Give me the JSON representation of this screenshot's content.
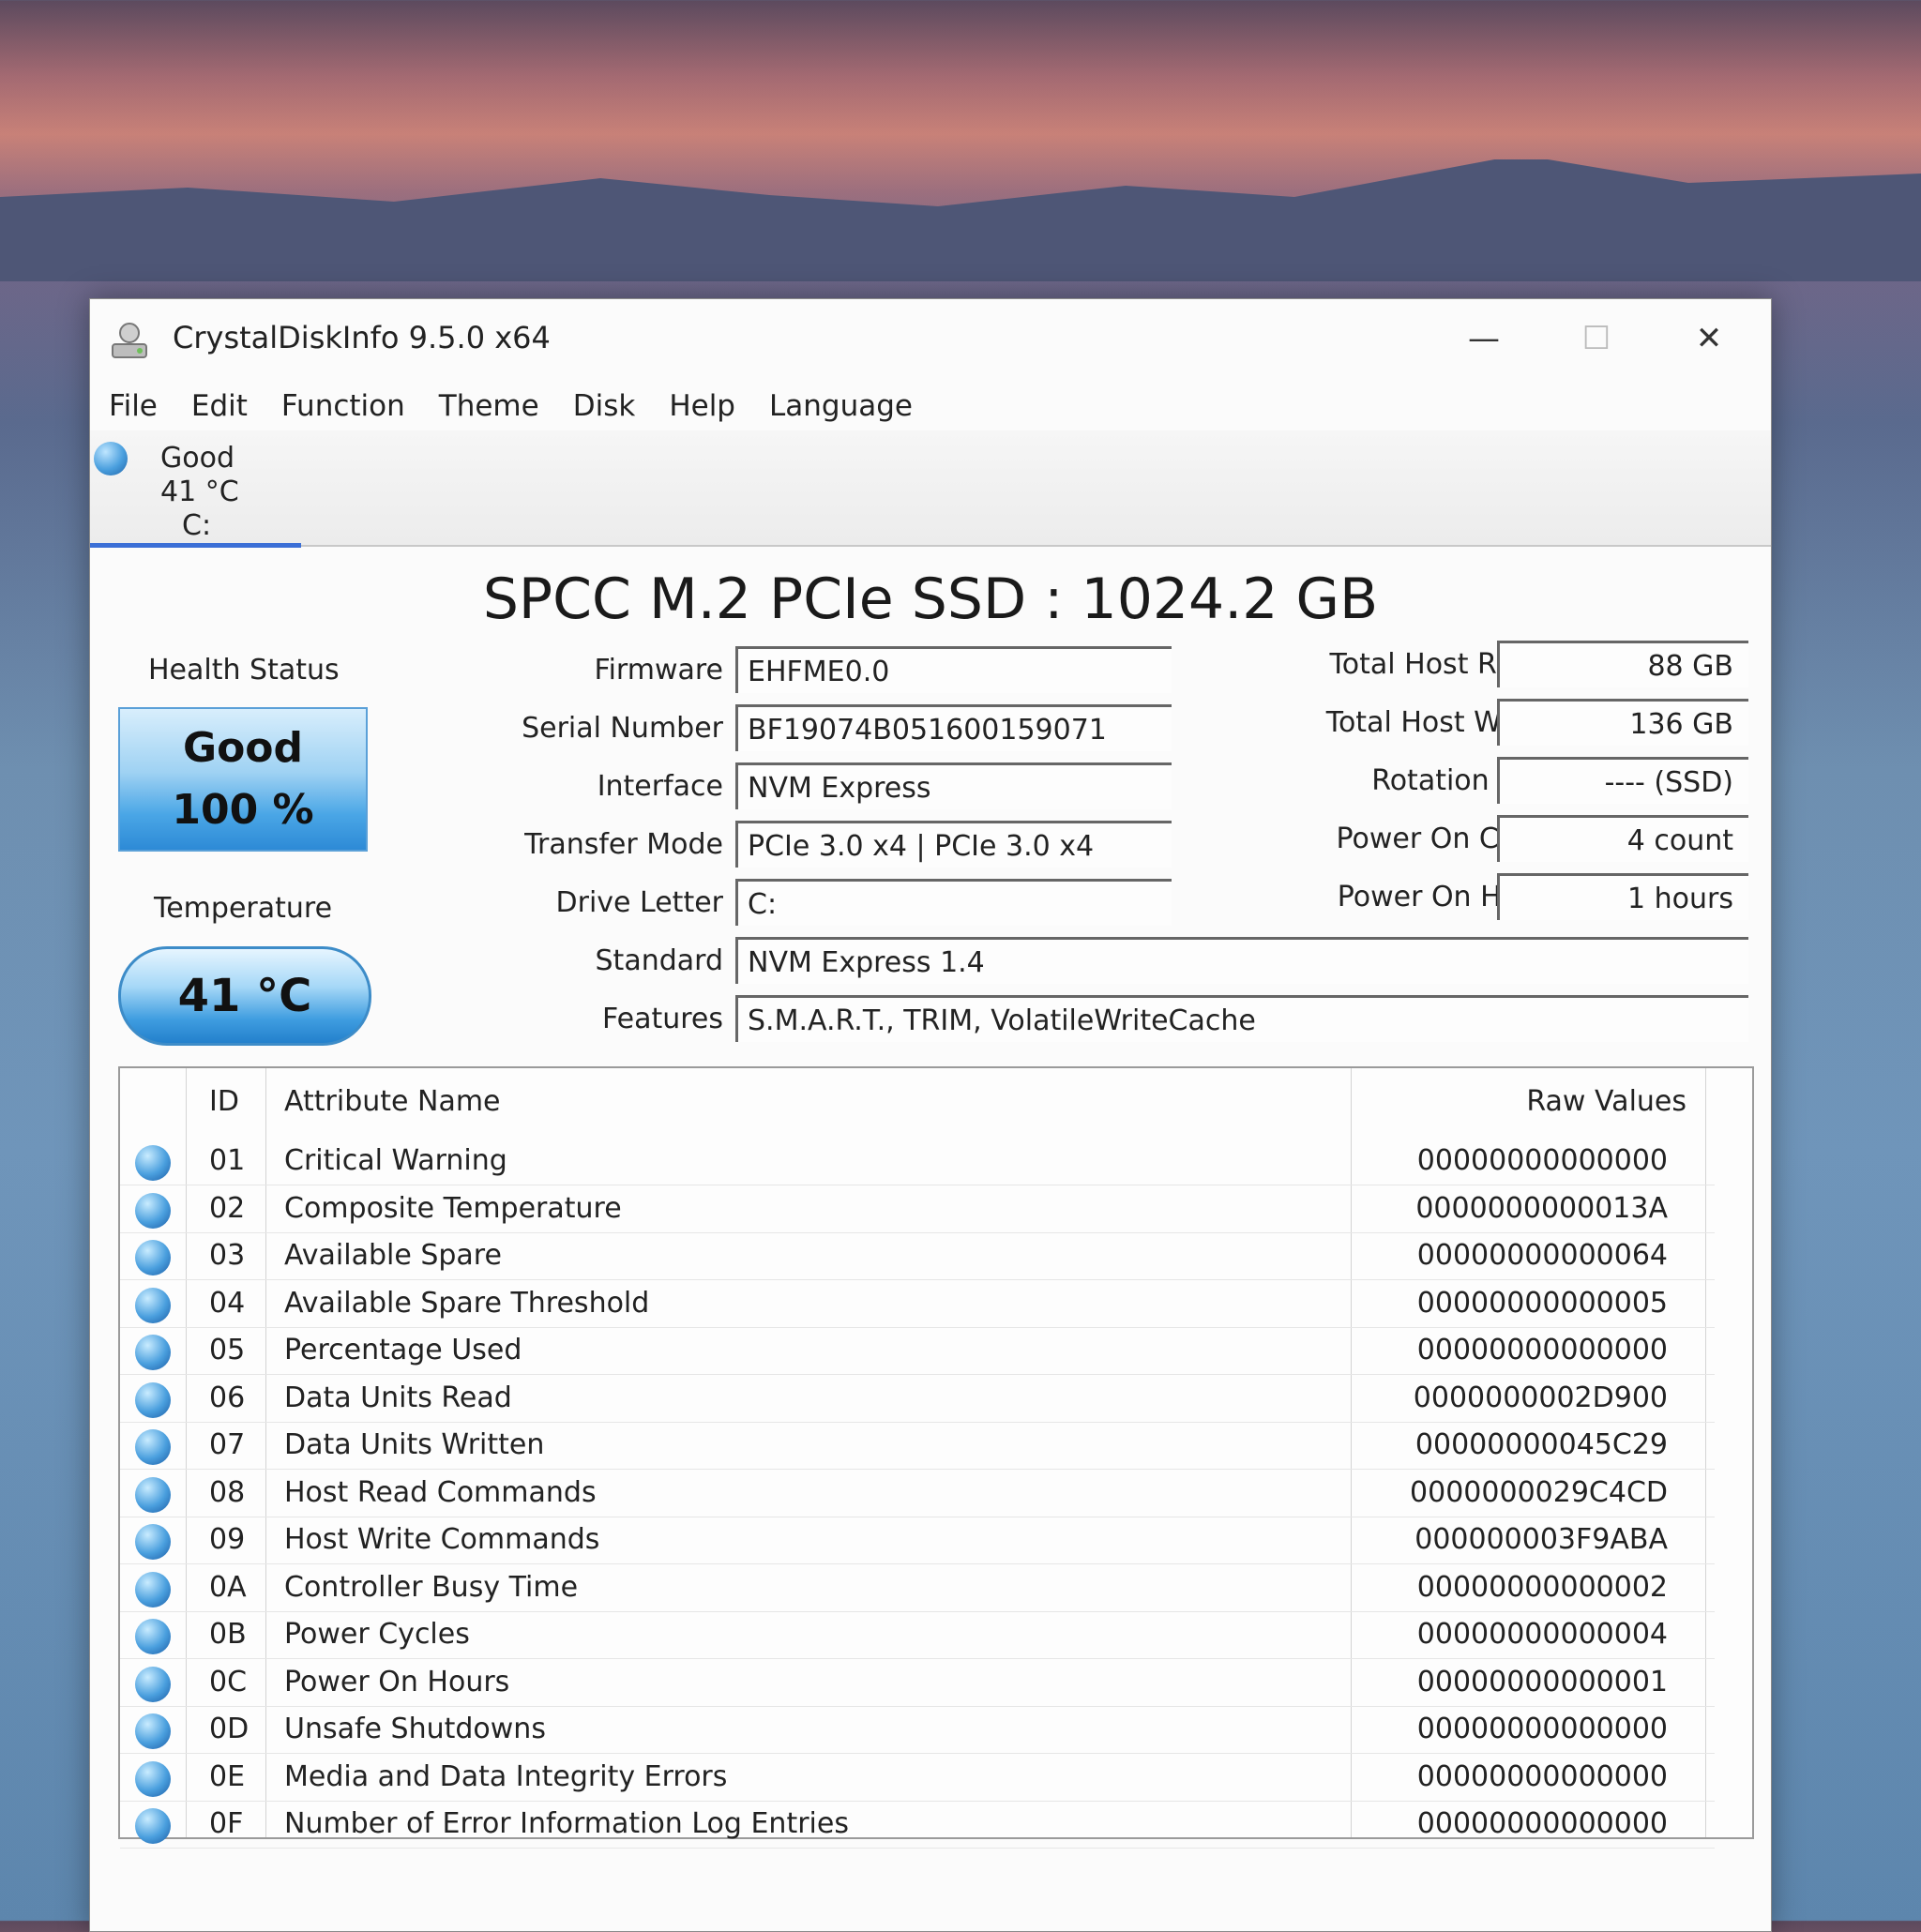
{
  "window": {
    "title": "CrystalDiskInfo 9.5.0 x64",
    "minimize": "—",
    "maximize": "☐",
    "close": "✕"
  },
  "menu": [
    "File",
    "Edit",
    "Function",
    "Theme",
    "Disk",
    "Help",
    "Language"
  ],
  "drive_tab": {
    "status": "Good",
    "temp": "41 °C",
    "letter": "C:",
    "status_color": "#4a9fde"
  },
  "model": "SPCC M.2 PCIe SSD : 1024.2 GB",
  "health": {
    "label": "Health Status",
    "status": "Good",
    "percent": "100 %",
    "color": "#4aa6e6"
  },
  "temperature": {
    "label": "Temperature",
    "value": "41 °C"
  },
  "info": [
    {
      "label": "Firmware",
      "value": "EHFME0.0"
    },
    {
      "label": "Serial Number",
      "value": "BF19074B051600159071"
    },
    {
      "label": "Interface",
      "value": "NVM Express"
    },
    {
      "label": "Transfer Mode",
      "value": "PCIe 3.0 x4 | PCIe 3.0 x4"
    },
    {
      "label": "Drive Letter",
      "value": "C:"
    },
    {
      "label": "Standard",
      "value": "NVM Express 1.4"
    },
    {
      "label": "Features",
      "value": "S.M.A.R.T., TRIM, VolatileWriteCache"
    }
  ],
  "stats": [
    {
      "label": "Total Host Reads",
      "value": "88 GB"
    },
    {
      "label": "Total Host Writes",
      "value": "136 GB"
    },
    {
      "label": "Rotation Rate",
      "value": "---- (SSD)"
    },
    {
      "label": "Power On Count",
      "value": "4 count"
    },
    {
      "label": "Power On Hours",
      "value": "1 hours"
    }
  ],
  "table": {
    "headers": {
      "id": "ID",
      "name": "Attribute Name",
      "raw": "Raw Values"
    },
    "rows": [
      {
        "id": "01",
        "name": "Critical Warning",
        "raw": "00000000000000"
      },
      {
        "id": "02",
        "name": "Composite Temperature",
        "raw": "0000000000013A"
      },
      {
        "id": "03",
        "name": "Available Spare",
        "raw": "00000000000064"
      },
      {
        "id": "04",
        "name": "Available Spare Threshold",
        "raw": "00000000000005"
      },
      {
        "id": "05",
        "name": "Percentage Used",
        "raw": "00000000000000"
      },
      {
        "id": "06",
        "name": "Data Units Read",
        "raw": "0000000002D900"
      },
      {
        "id": "07",
        "name": "Data Units Written",
        "raw": "00000000045C29"
      },
      {
        "id": "08",
        "name": "Host Read Commands",
        "raw": "0000000029C4CD"
      },
      {
        "id": "09",
        "name": "Host Write Commands",
        "raw": "000000003F9ABA"
      },
      {
        "id": "0A",
        "name": "Controller Busy Time",
        "raw": "00000000000002"
      },
      {
        "id": "0B",
        "name": "Power Cycles",
        "raw": "00000000000004"
      },
      {
        "id": "0C",
        "name": "Power On Hours",
        "raw": "00000000000001"
      },
      {
        "id": "0D",
        "name": "Unsafe Shutdowns",
        "raw": "00000000000000"
      },
      {
        "id": "0E",
        "name": "Media and Data Integrity Errors",
        "raw": "00000000000000"
      },
      {
        "id": "0F",
        "name": "Number of Error Information Log Entries",
        "raw": "00000000000000"
      }
    ]
  }
}
